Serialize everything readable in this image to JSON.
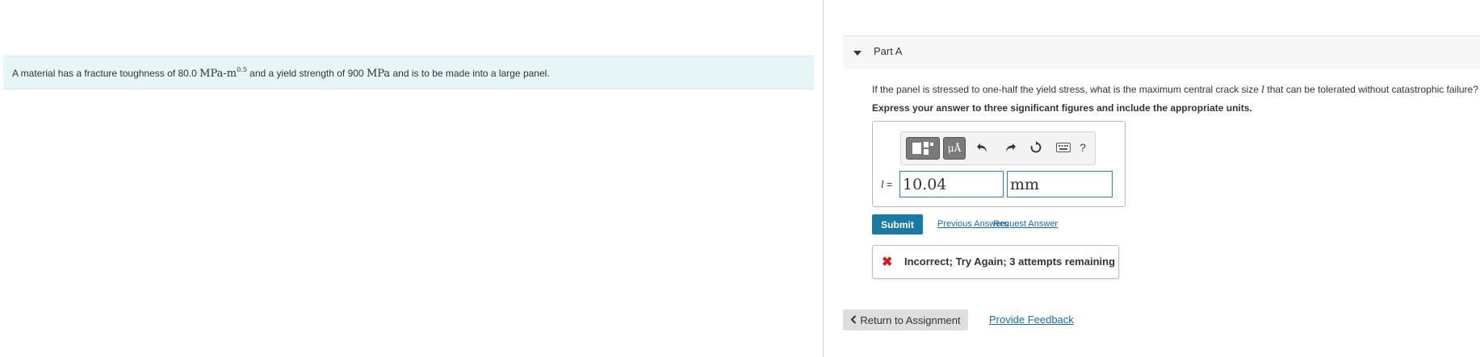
{
  "problem": {
    "text_before": "A material has a fracture toughness of 80.0 ",
    "unit1": "MPa-m",
    "unit1_exp": "0.5",
    "text_middle": " and a yield strength of 900 ",
    "unit2": "MPa",
    "text_after": " and is to be made into a large panel."
  },
  "part": {
    "title": "Part A",
    "question_before": "If the panel is stressed to one-half the yield stress, what is the maximum central crack size ",
    "question_var": "l",
    "question_after": " that can be tolerated without catastrophic failure?",
    "instruction": "Express your answer to three significant figures and include the appropriate units."
  },
  "toolbar": {
    "units_label": "μÅ",
    "help_label": "?"
  },
  "answer": {
    "var": "l",
    "equals": " =",
    "value": "10.04",
    "units": "mm"
  },
  "actions": {
    "submit": "Submit",
    "previous_answers": "Previous Answers",
    "request_answer": "Request Answer"
  },
  "feedback": {
    "icon": "✖",
    "text": "Incorrect; Try Again; 3 attempts remaining"
  },
  "footer": {
    "return_label": "Return to Assignment",
    "provide_feedback": "Provide Feedback"
  }
}
